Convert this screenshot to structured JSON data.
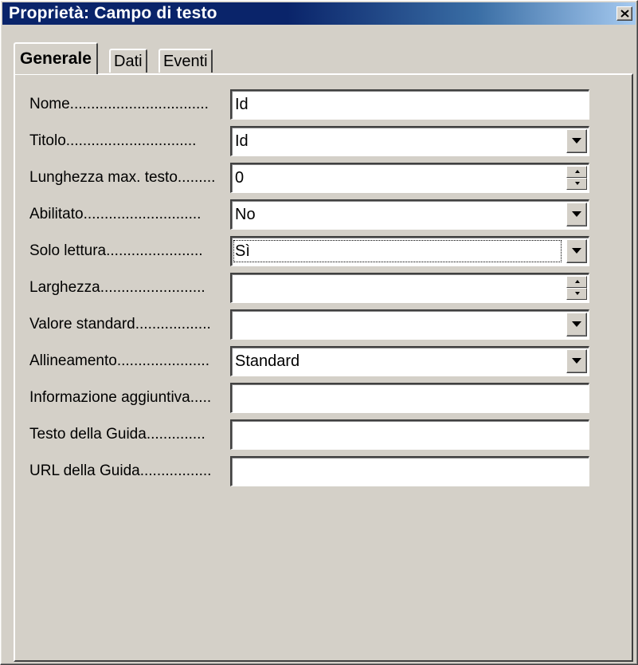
{
  "window": {
    "title": "Proprietà:  Campo di testo",
    "close_icon": "close-icon"
  },
  "tabs": [
    {
      "label": "Generale",
      "active": true
    },
    {
      "label": "Dati",
      "active": false
    },
    {
      "label": "Eventi",
      "active": false
    }
  ],
  "fields": [
    {
      "label": "Nome.................................",
      "value": "Id",
      "control": "text"
    },
    {
      "label": "Titolo...............................",
      "value": "Id",
      "control": "dropdown"
    },
    {
      "label": "Lunghezza max. testo.........",
      "value": "0",
      "control": "spinner"
    },
    {
      "label": "Abilitato............................",
      "value": "No",
      "control": "dropdown"
    },
    {
      "label": "Solo lettura.......................",
      "value": "Sì",
      "control": "dropdown",
      "focused": true
    },
    {
      "label": "Larghezza.........................",
      "value": "",
      "control": "spinner"
    },
    {
      "label": "Valore standard..................",
      "value": "",
      "control": "dropdown"
    },
    {
      "label": "Allineamento......................",
      "value": "Standard",
      "control": "dropdown"
    },
    {
      "label": "Informazione aggiuntiva.....",
      "value": "",
      "control": "text"
    },
    {
      "label": "Testo della Guida..............",
      "value": "",
      "control": "text"
    },
    {
      "label": "URL della Guida.................",
      "value": "",
      "control": "text"
    }
  ]
}
